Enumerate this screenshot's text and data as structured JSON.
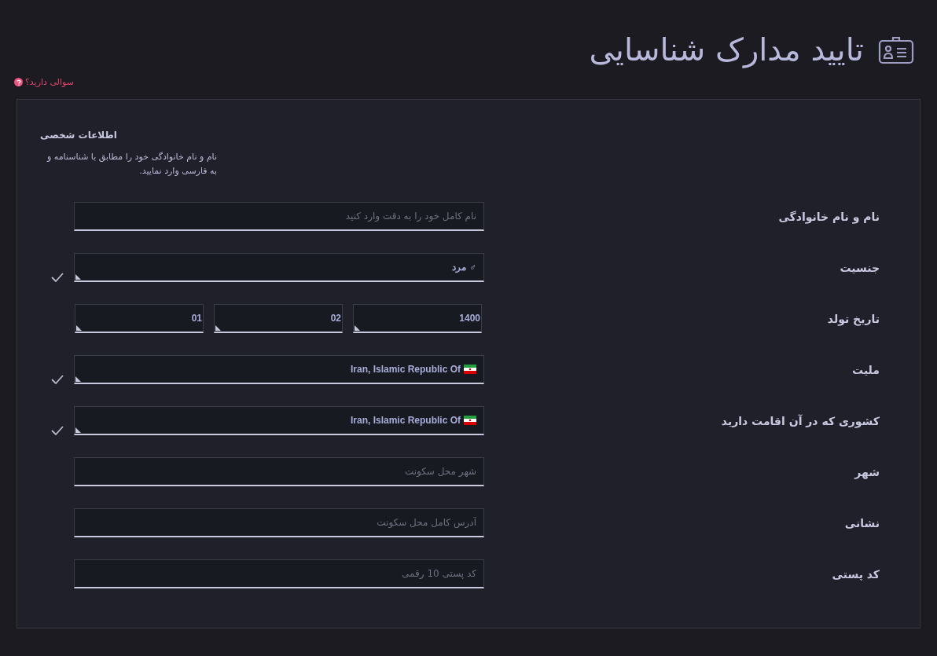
{
  "page_title": "تایید مدارک شناسایی",
  "help_link": "سوالی دارید؟",
  "section": {
    "title": "اطلاعات شخصی",
    "description": "نام و نام خانوادگی خود را مطابق با شناسنامه و به فارسی وارد نمایید."
  },
  "fields": [
    {
      "kind": "text",
      "label": "نام و نام خانوادگی",
      "placeholder": "نام کامل خود را به دقت وارد کنید",
      "valid": false
    },
    {
      "kind": "select",
      "label": "جنسیت",
      "symbol": "♂",
      "value": "مرد",
      "valid": true
    },
    {
      "kind": "date",
      "label": "تاریخ تولد",
      "parts": [
        "1400",
        "02",
        "01"
      ],
      "valid": false
    },
    {
      "kind": "country",
      "label": "ملیت",
      "value": "Iran, Islamic Republic Of",
      "valid": true
    },
    {
      "kind": "country",
      "label": "کشوری که در آن اقامت دارید",
      "value": "Iran, Islamic Republic Of",
      "valid": true
    },
    {
      "kind": "text",
      "label": "شهر",
      "placeholder": "شهر محل سکونت",
      "valid": false
    },
    {
      "kind": "text",
      "label": "نشانی",
      "placeholder": "آدرس کامل محل سکونت",
      "valid": false
    },
    {
      "kind": "text",
      "label": "کد پستی",
      "placeholder": "کد پستی 10 رقمی",
      "valid": false
    }
  ]
}
